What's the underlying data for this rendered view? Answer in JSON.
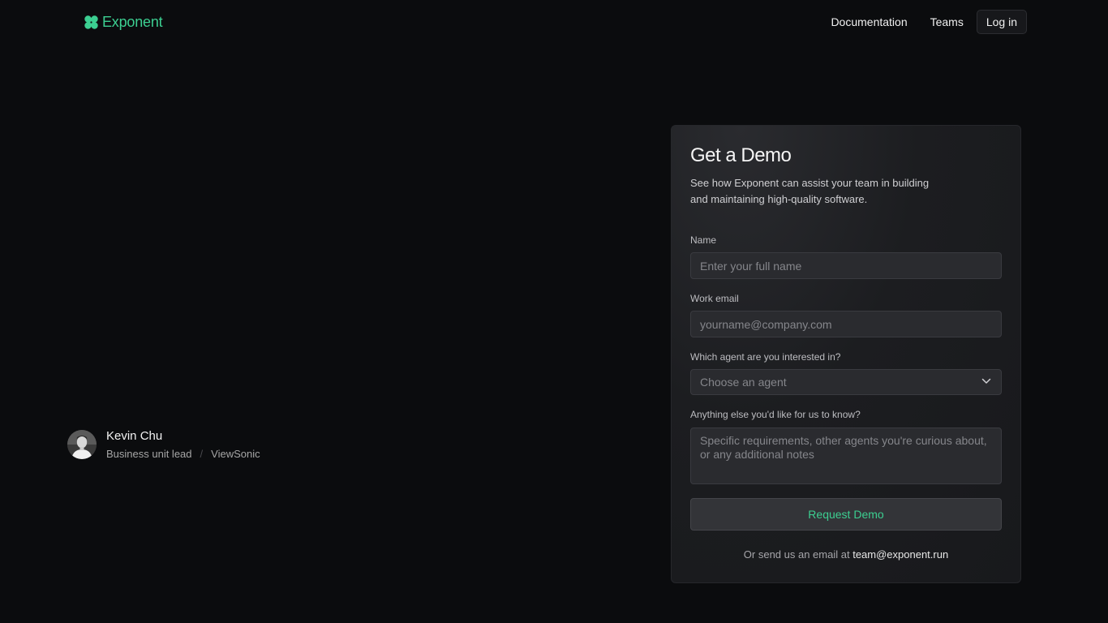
{
  "brand": {
    "name": "Exponent",
    "accent_color": "#3ccf91",
    "logo_icon": "clover-logo-icon"
  },
  "nav": {
    "documentation": "Documentation",
    "teams": "Teams",
    "login": "Log in"
  },
  "testimonial": {
    "name": "Kevin Chu",
    "role": "Business unit lead",
    "separator": "/",
    "company": "ViewSonic",
    "avatar_icon": "person-avatar"
  },
  "form": {
    "title": "Get a Demo",
    "description": "See how Exponent can assist your team in building and maintaining high-quality software.",
    "name_label": "Name",
    "name_placeholder": "Enter your full name",
    "email_label": "Work email",
    "email_placeholder": "yourname@company.com",
    "agent_label": "Which agent are you interested in?",
    "agent_placeholder": "Choose an agent",
    "agent_icon": "chevron-down-icon",
    "notes_label": "Anything else you'd like for us to know?",
    "notes_placeholder": "Specific requirements, other agents you're curious about, or any additional notes",
    "submit_label": "Request Demo",
    "email_prompt": "Or send us an email at",
    "contact_email": "team@exponent.run"
  }
}
